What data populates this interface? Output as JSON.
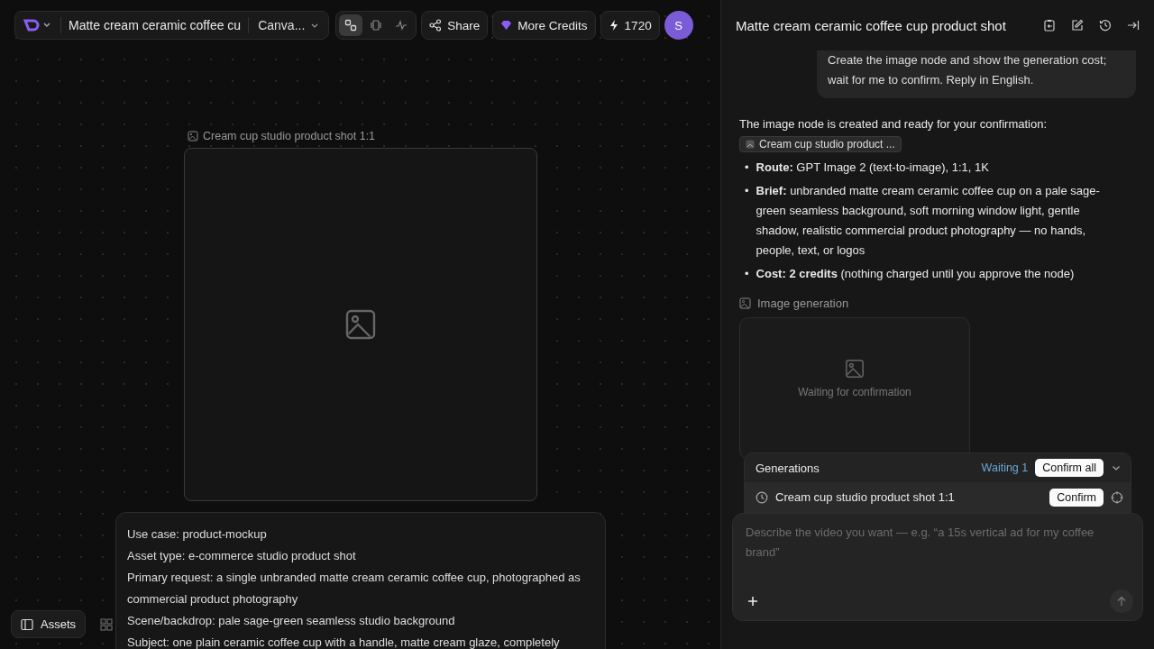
{
  "toolbar": {
    "project_title": "Matte cream ceramic coffee cu",
    "view_menu": "Canva...",
    "modes": [
      {
        "kind": "nodes",
        "selected": true
      },
      {
        "kind": "slides",
        "selected": false
      },
      {
        "kind": "activity",
        "selected": false
      }
    ],
    "share": "Share",
    "more_credits": "More Credits",
    "credits": "1720",
    "avatar": "S"
  },
  "canvas": {
    "node": {
      "label": "Cream cup studio product shot 1:1"
    },
    "prompt_lines": [
      "Use case: product-mockup",
      "Asset type: e-commerce studio product shot",
      "Primary request: a single unbranded matte cream ceramic coffee cup, photographed as commercial product photography",
      "Scene/backdrop: pale sage-green seamless studio background",
      "Subject: one plain ceramic coffee cup with a handle, matte cream glaze, completely"
    ],
    "assets": "Assets"
  },
  "panel": {
    "title": "Matte cream ceramic coffee cup product shot",
    "user_message": "Create the image node and show the generation cost; wait for me to confirm. Reply in English.",
    "reply": {
      "intro": "The image node is created and ready for your confirmation:",
      "chip": "Cream cup studio product ...",
      "bullet_marker": "•",
      "bullets": [
        "**Route:** GPT Image 2 (text-to-image), 1:1, 1K",
        "**Brief:** unbranded matte cream ceramic coffee cup on a pale sage-green seamless background, soft morning window light, gentle shadow, realistic commercial product photography — no hands, people, text, or logos",
        "**Cost: 2 credits** (nothing charged until you approve the node)"
      ]
    },
    "image_generation": {
      "label": "Image generation",
      "status": "Waiting for confirmation"
    },
    "generations": {
      "title": "Generations",
      "waiting": "Waiting 1",
      "confirm_all": "Confirm all",
      "items": [
        {
          "name": "Cream cup studio product shot 1:1",
          "confirm": "Confirm"
        }
      ]
    },
    "composer": {
      "placeholder": "Describe the video you want — e.g. “a 15s vertical ad for my coffee brand”"
    }
  }
}
